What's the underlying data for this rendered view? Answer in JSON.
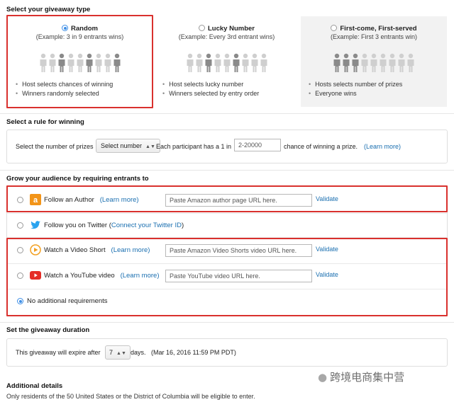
{
  "type_section": {
    "title": "Select your giveaway type",
    "options": [
      {
        "name": "Random",
        "example": "(Example: 3 in 9 entrants wins)",
        "bullets": [
          "Host selects chances of winning",
          "Winners randomly selected"
        ],
        "selected": true
      },
      {
        "name": "Lucky Number",
        "example": "(Example: Every 3rd entrant wins)",
        "bullets": [
          "Host selects lucky number",
          "Winners selected by entry order"
        ],
        "selected": false
      },
      {
        "name": "First-come, First-served",
        "example": "(Example: First 3 entrants win)",
        "bullets": [
          "Hosts selects number of prizes",
          "Everyone wins"
        ],
        "selected": false
      }
    ]
  },
  "rule_section": {
    "title": "Select a rule for winning",
    "prizes_label": "Select the number of prizes",
    "prizes_select": "Select number",
    "chance_label": "Each participant has a 1 in",
    "chance_placeholder": "2-20000",
    "chance_suffix": "chance of winning a prize.",
    "learn_more": "(Learn more)"
  },
  "grow_section": {
    "title": "Grow your audience by requiring entrants to",
    "author": {
      "label": "Follow an Author",
      "learn": "(Learn more)",
      "placeholder": "Paste Amazon author page URL here.",
      "validate": "Validate"
    },
    "twitter": {
      "label": "Follow you on Twitter (",
      "connect": "Connect your Twitter ID",
      "close": ")"
    },
    "video_short": {
      "label": "Watch a Video Short",
      "learn": "(Learn more)",
      "placeholder": "Paste Amazon Video Shorts video URL here.",
      "validate": "Validate"
    },
    "youtube": {
      "label": "Watch a YouTube video",
      "learn": "(Learn more)",
      "placeholder": "Paste YouTube video URL here.",
      "validate": "Validate"
    },
    "none": {
      "label": "No additional requirements"
    }
  },
  "duration_section": {
    "title": "Set the giveaway duration",
    "prefix": "This giveaway will expire after",
    "days_value": "7",
    "suffix": "days.",
    "date": "(Mar 16, 2016 11:59 PM PDT)"
  },
  "details_section": {
    "title": "Additional details",
    "text": "Only residents of the 50 United States or the District of Columbia will be eligible to enter."
  },
  "watermark": {
    "text": "跨境电商集中营"
  },
  "colors": {
    "accent": "#3d8ee6",
    "highlight": "#d9312e",
    "link": "#1a6fb0"
  }
}
